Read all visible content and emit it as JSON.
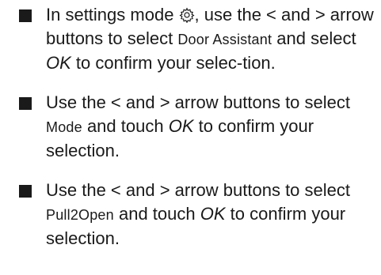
{
  "instructions": {
    "items": [
      {
        "parts": {
          "a": "In settings mode ",
          "icon": "gear-icon",
          "b": ", use the < and > arrow buttons to select ",
          "display": "Door Assistant",
          "c": " and select ",
          "key": "OK",
          "d": " to confirm your selec-tion."
        }
      },
      {
        "parts": {
          "a": "Use the < and > arrow buttons to select ",
          "display": "Mode",
          "b": " and touch ",
          "key": "OK",
          "c": " to confirm your selection."
        }
      },
      {
        "parts": {
          "a": "Use the < and > arrow buttons to select ",
          "display": "Pull2Open",
          "b": " and touch ",
          "key": "OK",
          "c": " to confirm your selection."
        }
      }
    ]
  }
}
